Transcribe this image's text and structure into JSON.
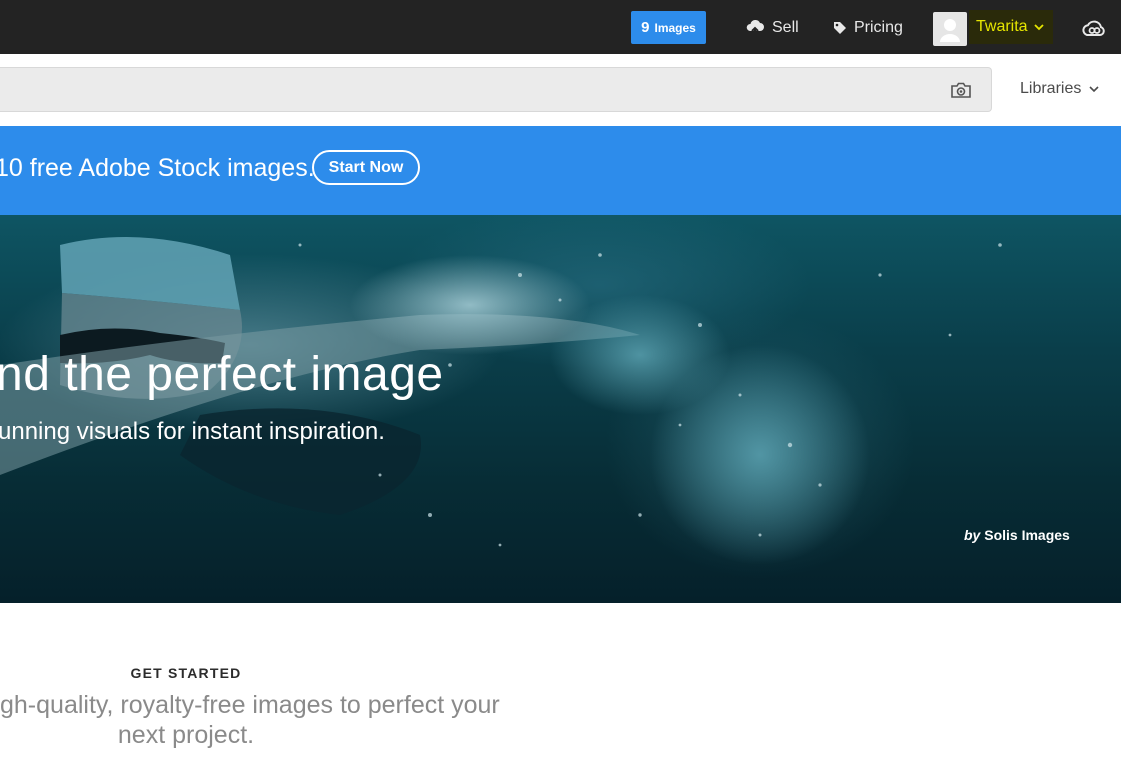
{
  "topbar": {
    "images_count": "9",
    "images_unit": "Images",
    "sell_label": "Sell",
    "pricing_label": "Pricing",
    "username": "Twarita",
    "icons": [
      "cloud-upload-icon",
      "tag-icon",
      "user-avatar-icon",
      "chevron-down-icon",
      "creative-cloud-icon"
    ]
  },
  "search": {
    "placeholder": "",
    "icon": "camera-icon",
    "libraries_label": "Libraries"
  },
  "promo": {
    "text": "10 free Adobe Stock images.",
    "button_label": "Start Now"
  },
  "hero": {
    "title": "nd the perfect image",
    "subtitle": "unning visuals for instant inspiration.",
    "credit_by": "by",
    "credit_name": "Solis Images"
  },
  "get_started": {
    "label": "GET STARTED",
    "line1": "gh-quality, royalty-free images to perfect your",
    "line2": "next project."
  },
  "colors": {
    "topbar_bg": "#232323",
    "accent_blue": "#2d8ceb",
    "username_highlight": "#e6e600"
  }
}
